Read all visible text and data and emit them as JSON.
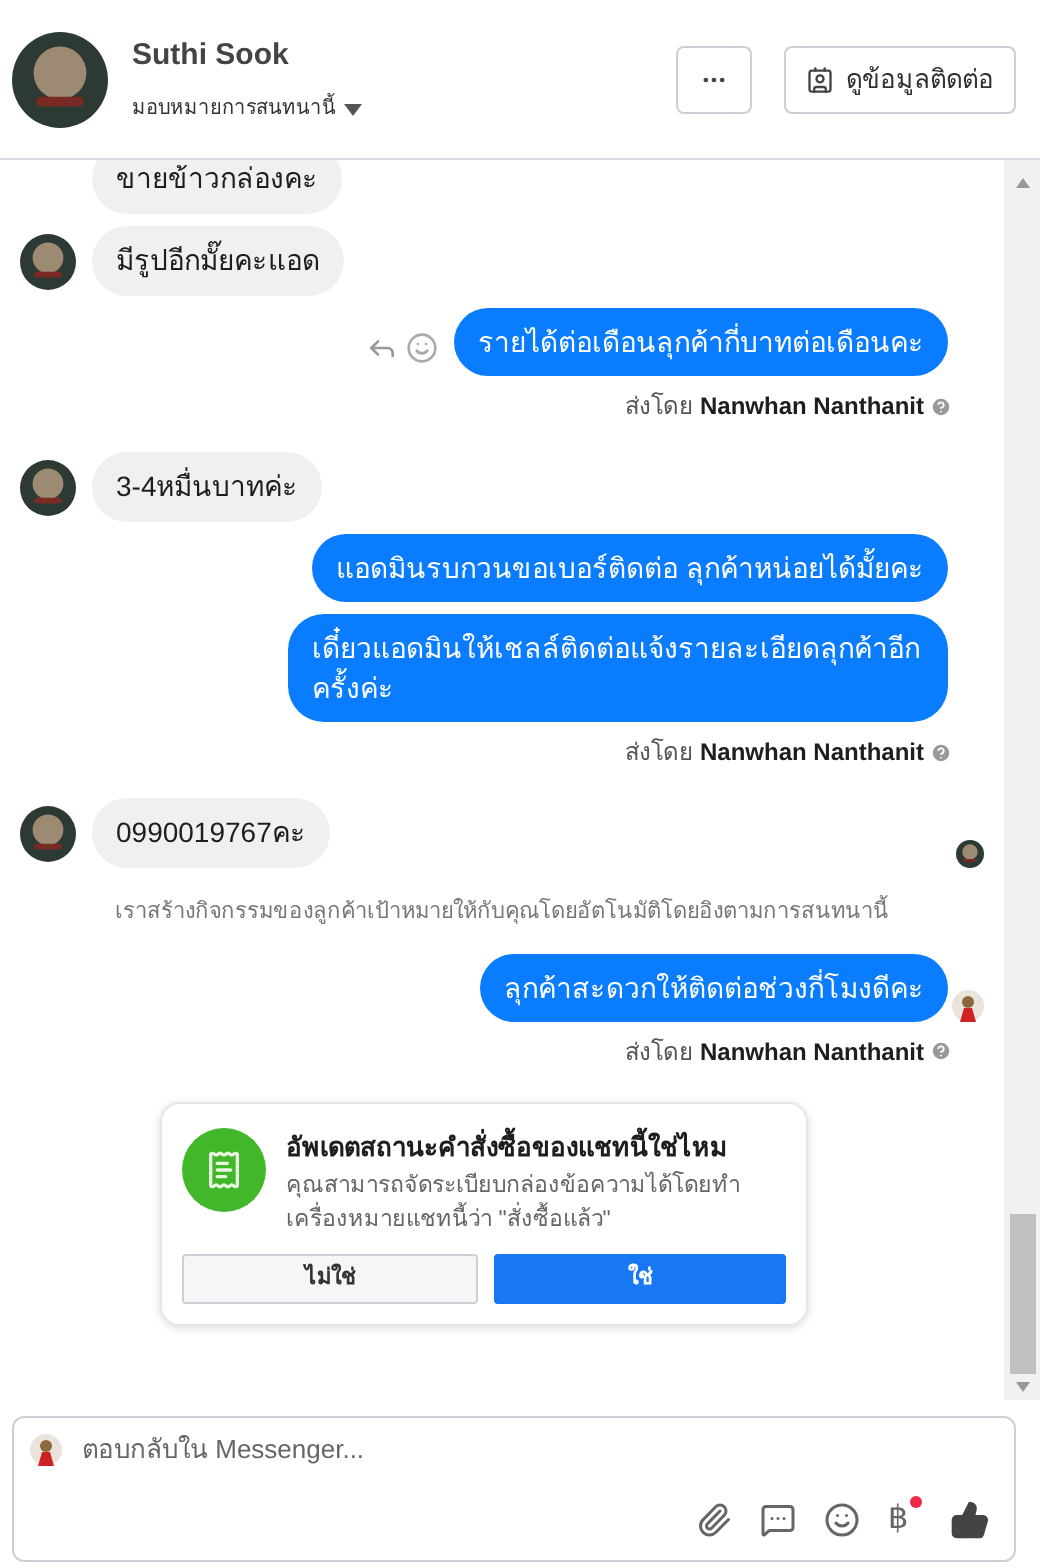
{
  "header": {
    "name": "Suthi Sook",
    "assign": "มอบหมายการสนทนานี้",
    "contact_button": "ดูข้อมูลติดต่อ"
  },
  "messages": [
    {
      "kind": "incoming",
      "text": "ขายข้าวกล่องคะ",
      "avatar": false,
      "seen": false
    },
    {
      "kind": "incoming",
      "text": "มีรูปอีกมั๊ยคะแอด",
      "avatar": true,
      "seen": false
    },
    {
      "kind": "outgoing",
      "text": "รายได้ต่อเดือนลุกค้ากี่บาทต่อเดือนคะ",
      "actions": true,
      "seen": false
    },
    {
      "kind": "sent_by",
      "prefix": "ส่งโดย",
      "name": "Nanwhan Nanthanit"
    },
    {
      "kind": "incoming",
      "text": "3-4หมื่นบาทค่ะ",
      "avatar": true,
      "seen": false
    },
    {
      "kind": "outgoing",
      "text": "แอดมินรบกวนขอเบอร์ติดต่อ ลุกค้าหน่อยได้มั้ยคะ",
      "actions": false,
      "seen": false
    },
    {
      "kind": "outgoing",
      "text": "เดี๋ยวแอดมินให้เชลล์ติดต่อแจ้งรายละเอียดลุกค้าอีกครั้งค่ะ",
      "actions": false,
      "seen": false
    },
    {
      "kind": "sent_by",
      "prefix": "ส่งโดย",
      "name": "Nanwhan Nanthanit"
    },
    {
      "kind": "incoming",
      "text": "0990019767คะ",
      "avatar": true,
      "seen": true
    },
    {
      "kind": "system",
      "text": "เราสร้างกิจกรรมของลูกค้าเป้าหมายให้กับคุณโดยอัตโนมัติโดยอิงตามการสนทนานี้"
    },
    {
      "kind": "outgoing",
      "text": "ลุกค้าสะดวกให้ติดต่อช่วงกี่โมงดีคะ",
      "actions": false,
      "seen": true
    },
    {
      "kind": "sent_by",
      "prefix": "ส่งโดย",
      "name": "Nanwhan Nanthanit"
    }
  ],
  "prompt": {
    "title": "อัพเดตสถานะคำสั่งซื้อของแชทนี้ใช่ไหม",
    "body": "คุณสามารถจัดระเบียบกล่องข้อความได้โดยทำเครื่องหมายแชทนี้ว่า \"สั่งซื้อแล้ว\"",
    "buttons": [
      {
        "label": "ไม่ใช่",
        "primary": false
      },
      {
        "label": "ใช่",
        "primary": true
      }
    ]
  },
  "composer": {
    "placeholder": "ตอบกลับใน Messenger...",
    "currency": "฿",
    "currency_badge": true
  }
}
